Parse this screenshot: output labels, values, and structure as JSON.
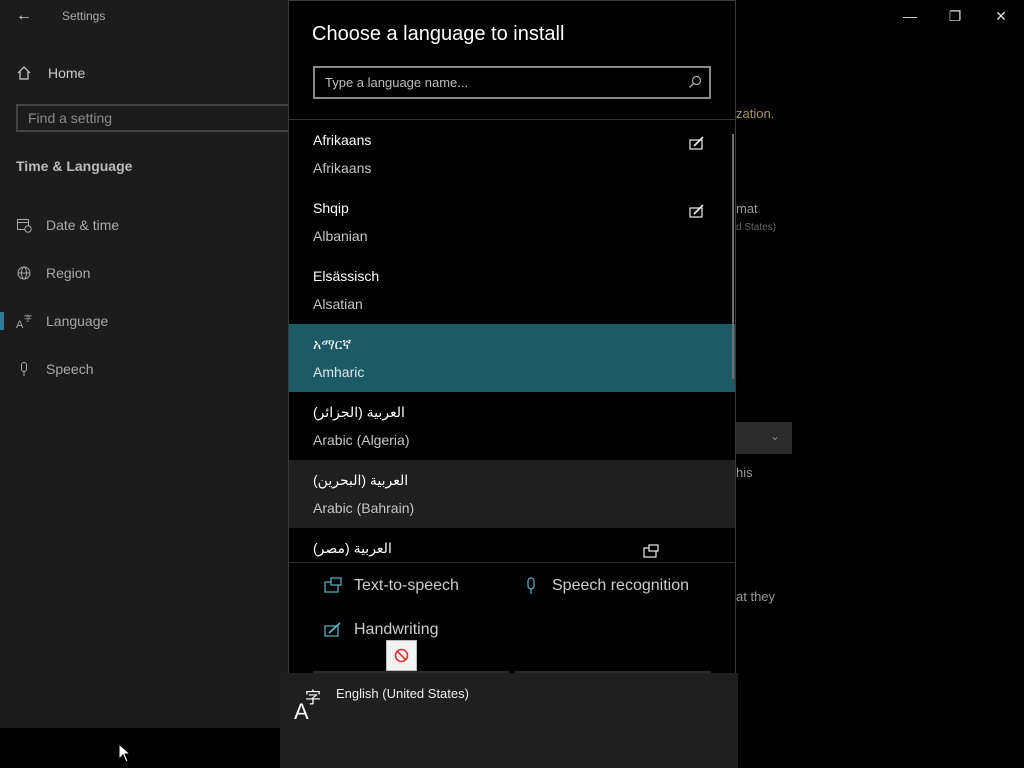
{
  "settings": {
    "window_title": "Settings",
    "home_label": "Home",
    "search_placeholder": "Find a setting",
    "section_title": "Time & Language",
    "nav": [
      {
        "label": "Date & time",
        "icon": "calendar-clock-icon"
      },
      {
        "label": "Region",
        "icon": "globe-icon"
      },
      {
        "label": "Language",
        "icon": "language-icon"
      },
      {
        "label": "Speech",
        "icon": "microphone-icon"
      }
    ],
    "active_nav": "Language",
    "peek_texts": {
      "t1": "zation.",
      "t2": "mat",
      "t3": "d States)",
      "t4": "his",
      "t5": "at they"
    }
  },
  "dialog": {
    "title": "Choose a language to install",
    "search_placeholder": "Type a language name...",
    "languages": [
      {
        "native": "Afrikaans",
        "english": "Afrikaans",
        "feature": "handwriting-icon"
      },
      {
        "native": "Shqip",
        "english": "Albanian",
        "feature": "handwriting-icon"
      },
      {
        "native": "Elsässisch",
        "english": "Alsatian",
        "feature": ""
      },
      {
        "native": "አማርኛ",
        "english": "Amharic",
        "feature": "",
        "state": "selected"
      },
      {
        "native": "العربية (الجزائر)",
        "english": "Arabic (Algeria)",
        "feature": ""
      },
      {
        "native": "العربية (البحرين)",
        "english": "Arabic (Bahrain)",
        "feature": "",
        "state": "hover"
      },
      {
        "native": "العربية (مصر)",
        "english": "",
        "feature": "text-to-speech-icon"
      }
    ],
    "legend": {
      "tts": "Text-to-speech",
      "speech": "Speech recognition",
      "handwriting": "Handwriting"
    }
  },
  "drag_item": {
    "label": "English (United States)"
  },
  "colors": {
    "selected_row": "#1c5a66",
    "accent": "#2d7d9a",
    "icon_teal": "#58b5c8"
  }
}
